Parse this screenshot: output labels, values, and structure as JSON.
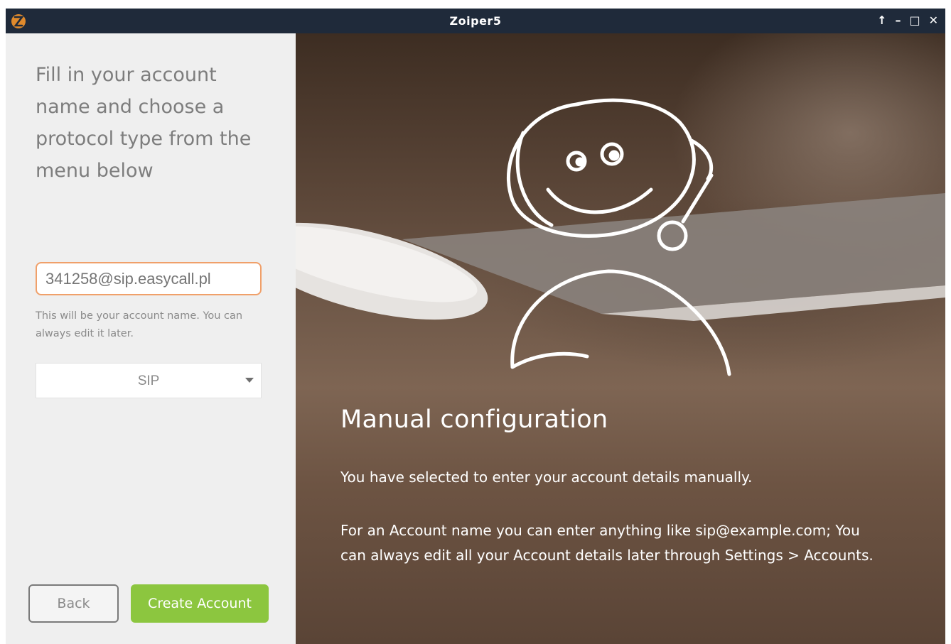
{
  "window": {
    "title": "Zoiper5",
    "controls": {
      "pin": "↑",
      "minimize": "–",
      "maximize": "□",
      "close": "✕"
    }
  },
  "left_panel": {
    "instructions": "Fill in your account name and choose a protocol type from the menu below",
    "account_name_value": "341258@sip.easycall.pl",
    "account_hint": "This will be your account name. You can always edit it later.",
    "protocol": {
      "selected": "SIP"
    },
    "buttons": {
      "back": "Back",
      "create_account": "Create Account"
    }
  },
  "right_panel": {
    "heading": "Manual configuration",
    "paragraph1": "You have selected to enter your account details manually.",
    "paragraph2": "For an Account name you can enter anything like sip@example.com; You can always edit all your Account details later through Settings > Accounts."
  },
  "colors": {
    "titlebar": "#1f2a3a",
    "accent_green": "#8cc63f",
    "input_border_orange": "#f0a06a",
    "panel_bg": "#efefef"
  },
  "icons": {
    "app": "zoiper-logo-icon",
    "protocol_dropdown": "caret-down-icon",
    "illustration": "support-agent-sketch"
  }
}
